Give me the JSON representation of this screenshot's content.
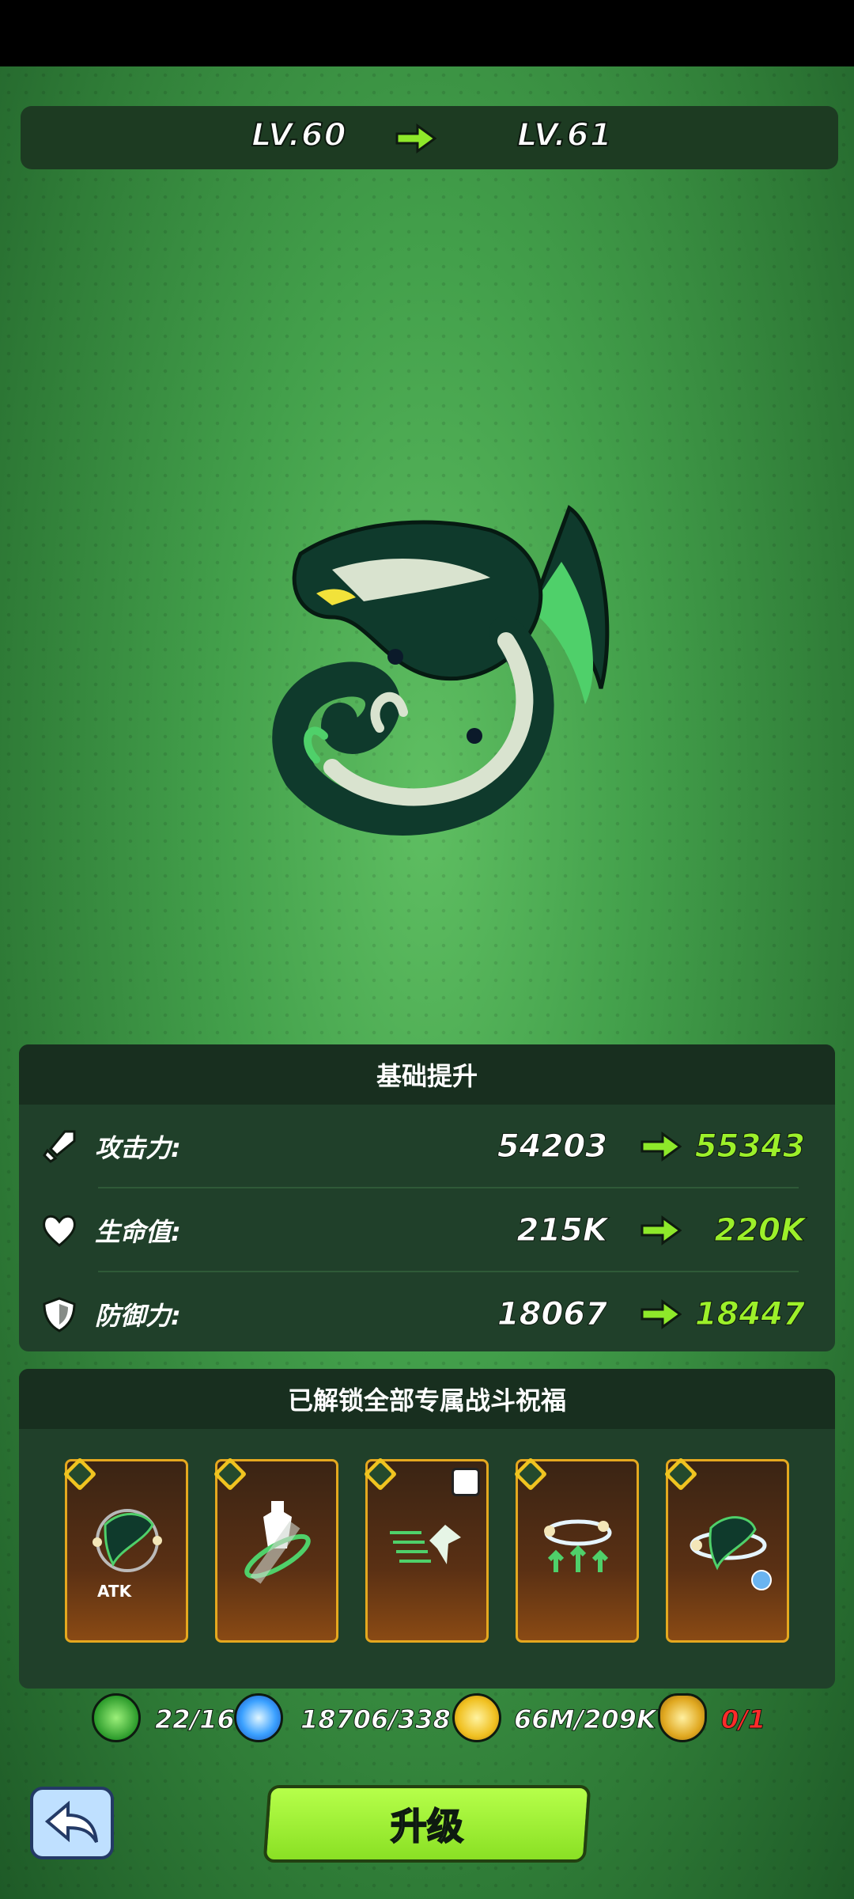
{
  "level": {
    "from": "LV.60",
    "to": "LV.61"
  },
  "base_panel": {
    "title": "基础提升",
    "stats": [
      {
        "icon": "sword-icon",
        "label": "攻击力:",
        "old": "54203",
        "new": "55343"
      },
      {
        "icon": "heart-icon",
        "label": "生命值:",
        "old": "215K",
        "new": "220K"
      },
      {
        "icon": "shield-icon",
        "label": "防御力:",
        "old": "18067",
        "new": "18447"
      }
    ]
  },
  "blessing_panel": {
    "title": "已解锁全部专属战斗祝福",
    "cards": [
      {
        "icon": "dragon-atk-icon",
        "label": "ATK"
      },
      {
        "icon": "warrior-ring-icon",
        "label": ""
      },
      {
        "icon": "dash-dragon-icon",
        "label": ""
      },
      {
        "icon": "orbit-arrows-icon",
        "label": ""
      },
      {
        "icon": "dragon-timer-icon",
        "label": ""
      }
    ]
  },
  "resources": [
    {
      "icon": "green-orb-icon",
      "text": "22/16",
      "color": "#3cc43c"
    },
    {
      "icon": "blue-star-orb-icon",
      "text": "18706/338",
      "color": "#2f8cf0"
    },
    {
      "icon": "gold-coin-icon",
      "text": "66M/209K",
      "color": "#f0c020"
    },
    {
      "icon": "golden-egg-icon",
      "text": "0/1",
      "color": "#ff2a2a"
    }
  ],
  "buttons": {
    "upgrade": "升级",
    "back": "back-arrow-icon"
  }
}
